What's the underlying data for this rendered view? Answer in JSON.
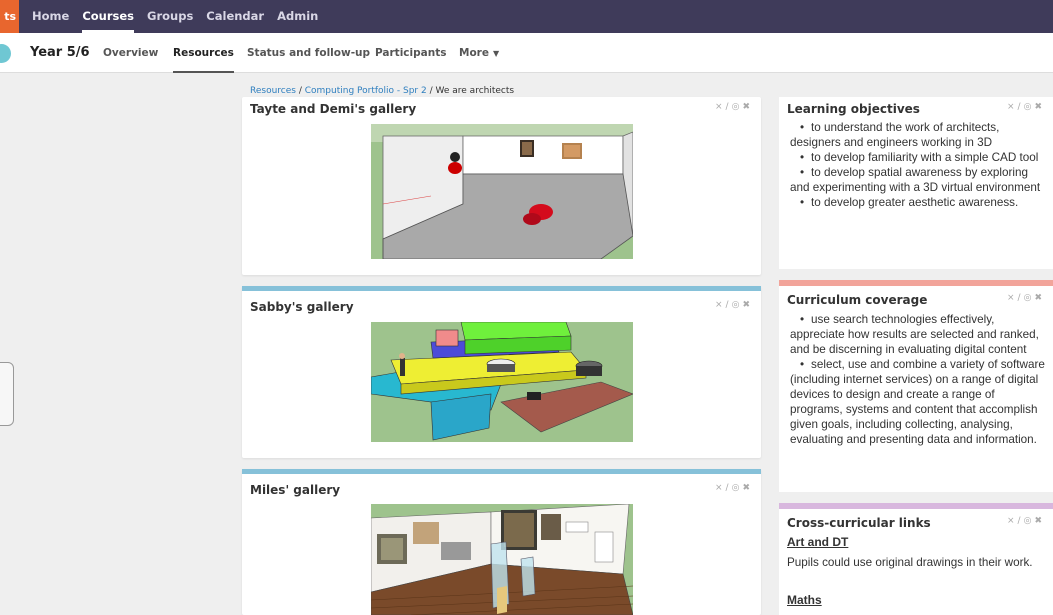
{
  "topnav": {
    "logo_text": "ts",
    "items": [
      {
        "label": "Home"
      },
      {
        "label": "Courses"
      },
      {
        "label": "Groups"
      },
      {
        "label": "Calendar"
      },
      {
        "label": "Admin"
      }
    ],
    "active": "Courses"
  },
  "course": {
    "title": "Year 5/6",
    "tabs": [
      {
        "label": "Overview"
      },
      {
        "label": "Resources"
      },
      {
        "label": "Status and follow-up"
      },
      {
        "label": "Participants"
      },
      {
        "label": "More"
      }
    ],
    "active_tab": "Resources"
  },
  "breadcrumb": {
    "parts": [
      "Resources",
      "Computing Portfolio - Spr 2",
      "We are architects"
    ],
    "separator": " / "
  },
  "tools": {
    "icons": [
      "resize-icon",
      "edit-icon",
      "settings-icon",
      "close-icon"
    ],
    "glyphs": [
      "⨯",
      "∕",
      "◎",
      "✖"
    ]
  },
  "galleries": [
    {
      "title": "Tayte and Demi's gallery",
      "accent": ""
    },
    {
      "title": "Sabby's gallery",
      "accent": "#86c1d9"
    },
    {
      "title": "Miles' gallery",
      "accent": "#86c1d9"
    }
  ],
  "learning_objectives": {
    "title": "Learning objectives",
    "accent": "",
    "items": [
      "to understand the work of architects, designers and engineers working in 3D",
      "to develop familiarity with a simple CAD tool",
      "to develop spatial awareness by exploring and experimenting with a 3D virtual environment",
      "to develop greater aesthetic awareness."
    ]
  },
  "curriculum_coverage": {
    "title": "Curriculum coverage",
    "accent": "#f2a49a",
    "items": [
      "use search technologies effectively, appreciate how results are selected and ranked, and be discerning in evaluating digital content",
      "select, use and combine a variety of software (including internet services) on a range of digital devices to design and create a range of programs, systems and content that accomplish given goals, including collecting, analysing, evaluating and presenting data and information."
    ]
  },
  "cross_curricular": {
    "title": "Cross-curricular links",
    "accent": "#d8b7de",
    "sections": [
      {
        "heading": "Art and DT",
        "text": "Pupils could use original drawings in their work."
      },
      {
        "heading": "Maths",
        "text": ""
      }
    ]
  }
}
